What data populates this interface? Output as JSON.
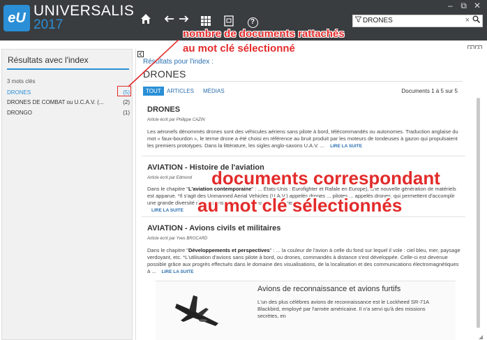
{
  "header": {
    "logo_text": "eU",
    "app_name": "UNIVERSALIS",
    "app_year": "2017",
    "window_controls": [
      "–",
      "⧉",
      "✕"
    ],
    "search": {
      "filter_icon": "funnel-icon",
      "value": "DRONES",
      "clear": "×",
      "go_icon": "magnifier-icon"
    },
    "nav_icons": [
      "home-icon",
      "back-icon",
      "forward-icon",
      "grid-icon",
      "document-icon",
      "help-icon"
    ]
  },
  "sidebar": {
    "title": "Résultats avec l'index",
    "keyword_count": "3 mots clés",
    "keywords": [
      {
        "label": "DRONES",
        "count": "(5)",
        "active": true
      },
      {
        "label": "DRONES DE COMBAT ou U.C.A.V. (...",
        "count": "(2)",
        "active": false
      },
      {
        "label": "DRONGO",
        "count": "(1)",
        "active": false
      }
    ]
  },
  "main": {
    "results_for": "Résultats pour l'index :",
    "keyword": "DRONES",
    "tabs": [
      {
        "label": "TOUT",
        "active": true
      },
      {
        "label": "ARTICLES",
        "active": false
      },
      {
        "label": "MÉDIAS",
        "active": false
      }
    ],
    "doc_counter": "Documents 1 à 5 sur 5",
    "results": [
      {
        "title": "DRONES",
        "author": "Article écrit par Philippe CAZIN",
        "text": "Les aéronefs dénommés drones sont des véhicules aériens sans pilote à bord, télécommandés ou autonomes. Traduction anglaise du mot « faux-bourdon », le terme drone a été choisi en référence au bruit produit par les moteurs de tondeuses à gazon qui propulsaient les premiers prototypes. Dans la littérature, les sigles anglo-saxons U.A.V. ...",
        "read_more": "LIRE LA SUITE"
      },
      {
        "title": "AVIATION - Histoire de l'aviation",
        "author": "Article écrit par Edmond",
        "text_before": "Dans le chapitre \"",
        "text_bold": "L'aviation contemporaine",
        "text_after": "\" : ... États-Unis : Eurofighter et Rafale en Europe), une nouvelle génération de matériels est apparue. *Il s'agit des Unmanned Aerial Vehicles (U.A.V.) appelés drones ... pilotes ... appelés drones, qui permettent d'accomplir une grande diversité de missions ... aux opérateurs ... l'expérience ... s'avancer par la durée ...",
        "read_more": "LIRE LA SUITE"
      },
      {
        "title": "AVIATION - Avions civils et militaires",
        "author": "Article écrit par Yves BROCARD",
        "text_before": "Dans le chapitre \"",
        "text_bold": "Développements et perspectives",
        "text_after": "\" : ... la couleur de l'avion à celle du fond sur lequel il vole : ciel bleu, mer, paysage verdoyant, etc. *L'utilisation d'avions sans pilote à bord, ou drones, commandés à distance s'est développée. Celle-ci est devenue possible grâce aux progrès effectués dans le domaine des visualisations, de la localisation et des communications électromagnétiques à ...",
        "read_more": "LIRE LA SUITE"
      }
    ],
    "media": {
      "title": "Avions de reconnaissance et avions furtifs",
      "text": "L'un des plus célèbres avions de reconnaissance est le Lockheed SR-71A Blackbird, employé par l'armée américaine. Il n'a servi qu'à des missions secrètes, en"
    }
  },
  "annotations": {
    "top_line1": "nombre de documents rattachés",
    "top_line2": "au mot clé sélectionné",
    "mid_line1": "documents correspondant",
    "mid_line2": "au mot clé sélectionnés"
  },
  "colors": {
    "accent": "#2a8fd6",
    "titlebar": "#3a3d40",
    "annotation": "#e32b2b"
  }
}
